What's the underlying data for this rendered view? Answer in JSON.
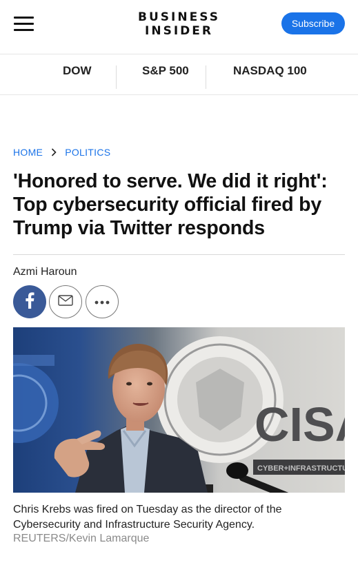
{
  "header": {
    "logo_line1": "BUSINESS",
    "logo_line2": "INSIDER",
    "subscribe_label": "Subscribe"
  },
  "markets": [
    "DOW",
    "S&P 500",
    "NASDAQ 100"
  ],
  "breadcrumb": {
    "home": "HOME",
    "section": "POLITICS"
  },
  "article": {
    "headline": "'Honored to serve. We did it right': Top cybersecurity official fired by Trump via Twitter responds",
    "author": "Azmi Haroun",
    "share_icons": [
      "facebook-icon",
      "mail-icon",
      "more-icon"
    ],
    "image": {
      "sign_text": "CISA",
      "sign_subtext": "CYBER+INFRASTRUCTURE",
      "caption": "Chris Krebs was fired on Tuesday as the director of the Cybersecurity and Infrastructure Security Agency.",
      "credit": "REUTERS/Kevin Lamarque"
    }
  },
  "colors": {
    "accent": "#1a73e8",
    "facebook": "#3a5a98"
  }
}
